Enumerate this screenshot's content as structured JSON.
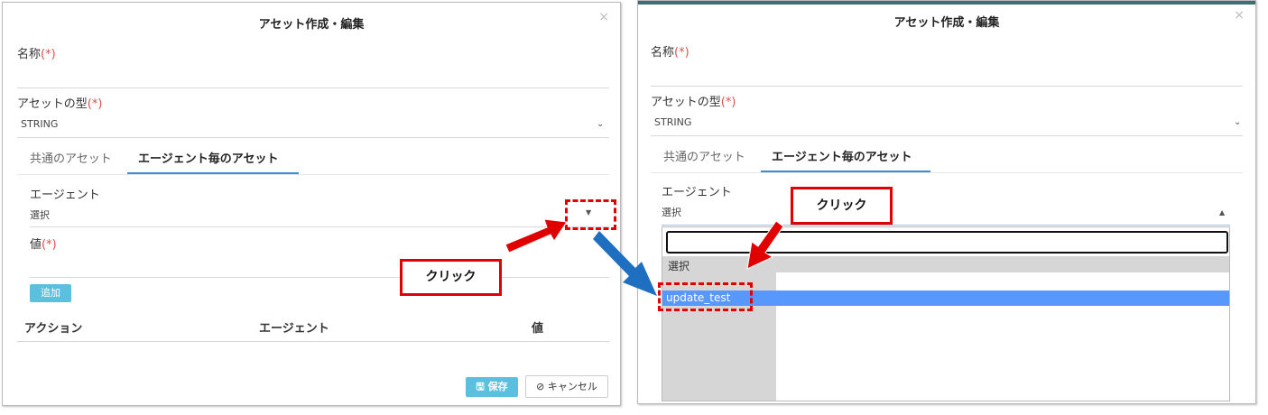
{
  "dialog": {
    "title": "アセット作成・編集",
    "close": "×",
    "name_label": "名称",
    "required_mark": "(*)",
    "type_label": "アセットの型",
    "type_value": "STRING",
    "tabs": [
      "共通のアセット",
      "エージェント毎のアセット"
    ],
    "agent_label": "エージェント",
    "agent_select": "選択",
    "value_label": "値",
    "add_button": "追加",
    "table_headers": [
      "アクション",
      "エージェント",
      "値"
    ],
    "save_button": "保存",
    "cancel_button": "キャンセル"
  },
  "dropdown": {
    "options": [
      "選択",
      "update_test"
    ],
    "selected": "update_test"
  },
  "annotations": {
    "click_left": "クリック",
    "click_right": "クリック"
  },
  "colors": {
    "accent": "#5bc0de",
    "tab_underline": "#3a8ed8",
    "highlight": "#5897fb",
    "annotation_red": "#e00000",
    "arrow_blue": "#1e6fc0"
  }
}
